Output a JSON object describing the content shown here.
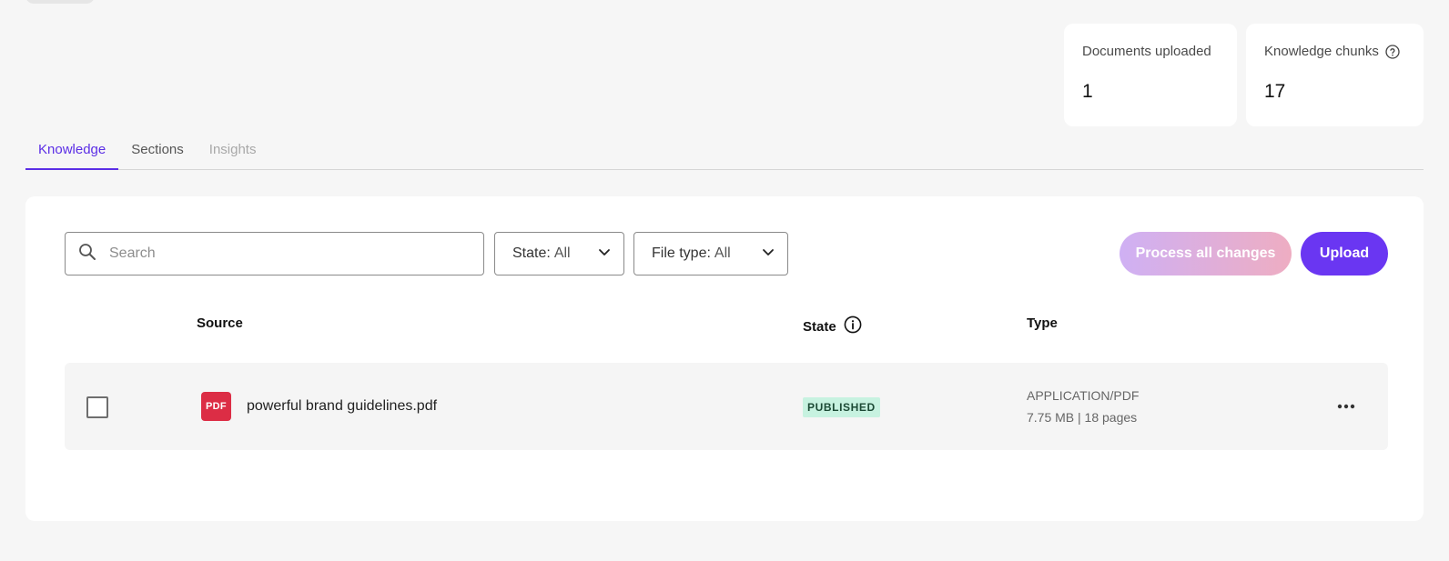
{
  "stats": {
    "documents_label": "Documents uploaded",
    "documents_value": "1",
    "chunks_label": "Knowledge chunks",
    "chunks_value": "17"
  },
  "tabs": [
    {
      "label": "Knowledge",
      "active": true
    },
    {
      "label": "Sections",
      "active": false
    },
    {
      "label": "Insights",
      "active": false,
      "disabled": true
    }
  ],
  "toolbar": {
    "search_placeholder": "Search",
    "state_key": "State:",
    "state_value": "All",
    "filetype_key": "File type:",
    "filetype_value": "All",
    "process_label": "Process all changes",
    "upload_label": "Upload"
  },
  "table": {
    "headers": {
      "source": "Source",
      "state": "State",
      "type": "Type"
    },
    "rows": [
      {
        "icon_label": "PDF",
        "filename": "powerful brand guidelines.pdf",
        "state": "PUBLISHED",
        "type": "APPLICATION/PDF",
        "meta": "7.75 MB | 18 pages"
      }
    ]
  },
  "colors": {
    "accent": "#5b2ee6",
    "upload_button": "#6a36f2",
    "pdf_icon": "#dc2d45",
    "published_badge_bg": "#c7f2e0"
  }
}
